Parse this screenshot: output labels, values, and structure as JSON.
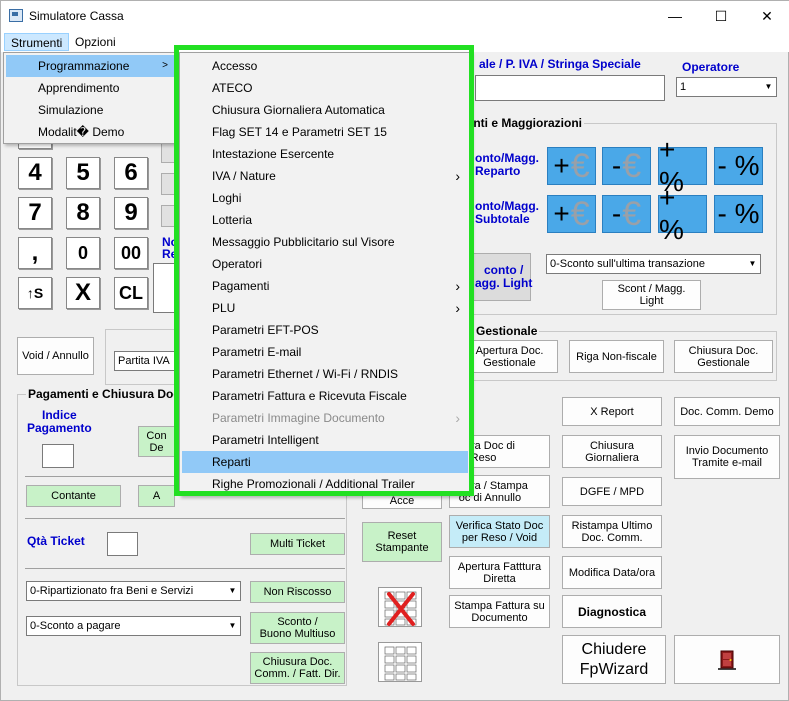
{
  "window": {
    "title": "Simulatore Cassa",
    "minimize": "—",
    "maximize": "☐",
    "close": "✕"
  },
  "menubar": {
    "strumenti": "Strumenti",
    "opzioni": "Opzioni"
  },
  "strumenti_menu": [
    "Programmazione",
    "Apprendimento",
    "Simulazione",
    "Modalit� Demo"
  ],
  "programmazione_menu": [
    {
      "label": "Accesso",
      "sub": false
    },
    {
      "label": "ATECO",
      "sub": false
    },
    {
      "label": "Chiusura Giornaliera Automatica",
      "sub": false
    },
    {
      "label": "Flag SET 14 e Parametri SET 15",
      "sub": false
    },
    {
      "label": "Intestazione Esercente",
      "sub": false
    },
    {
      "label": "IVA / Nature",
      "sub": true
    },
    {
      "label": "Loghi",
      "sub": false
    },
    {
      "label": "Lotteria",
      "sub": false
    },
    {
      "label": "Messaggio Pubblicitario sul Visore",
      "sub": false
    },
    {
      "label": "Operatori",
      "sub": false
    },
    {
      "label": "Pagamenti",
      "sub": true
    },
    {
      "label": "PLU",
      "sub": true
    },
    {
      "label": "Parametri EFT-POS",
      "sub": false
    },
    {
      "label": "Parametri E-mail",
      "sub": false
    },
    {
      "label": "Parametri Ethernet / Wi-Fi / RNDIS",
      "sub": false
    },
    {
      "label": "Parametri Fattura e Ricevuta Fiscale",
      "sub": false
    },
    {
      "label": "Parametri Immagine Documento",
      "sub": true,
      "disabled": true
    },
    {
      "label": "Parametri Intelligent",
      "sub": false
    },
    {
      "label": "Reparti",
      "sub": false,
      "highlighted": true
    },
    {
      "label": "Righe Promozionali / Additional Trailer",
      "sub": false
    }
  ],
  "header": {
    "cf_label": "ale / P. IVA / Stringa Speciale",
    "operatore_label": "Operatore",
    "operatore_value": "1"
  },
  "keypad": [
    "5",
    "6",
    "7",
    "8",
    "9",
    ",",
    "0",
    "00",
    "↑S",
    "X",
    "CL"
  ],
  "keypad_top": "4",
  "left_side": {
    "no_label": "No",
    "re_label": "Re",
    "void_annullo": "Void / Annullo",
    "partita_iva": "Partita IVA"
  },
  "sconti": {
    "title": "onti e Maggiorazioni",
    "reparto_label": "onto/Magg.\nReparto",
    "subtotale_label": "onto/Magg.\nSubtotale",
    "light_label": "conto /\nagg. Light",
    "plus_euro": "+€",
    "minus_euro": "-€",
    "plus_pct": "+ %",
    "minus_pct": "- %",
    "sconto_combo": "0-Sconto sull'ultima transazione",
    "scont_light_btn": "Scont / Magg.\nLight"
  },
  "gestionale": {
    "title": "c Gestionale",
    "apertura": "Apertura Doc.\nGestionale",
    "riga": "Riga Non-fiscale",
    "chiusura": "Chiusura Doc.\nGestionale"
  },
  "pagamenti": {
    "title": "Pagamenti e Chiusura Doc",
    "indice_label": "Indice\nPagamento",
    "con_de": "Con\nDe",
    "contante": "Contante",
    "a_btn": "A",
    "qta_label": "Qtà Ticket",
    "multi_ticket": "Multi Ticket",
    "ripart_combo": "0-Ripartizionato fra Beni e Servizi",
    "non_riscosso": "Non Riscosso",
    "sconto_combo": "0-Sconto a pagare",
    "sconto_buono": "Sconto /\nBuono Multiuso",
    "chiusura_doc": "Chiusura Doc.\nComm. / Fatt. Dir."
  },
  "middle": {
    "apertura_reso": "ertura Doc di\nReso",
    "apertura_annullo": "ertura / Stampa\noc di Annullo",
    "hidden_btn": "Acce",
    "reset": "Reset\nStampante",
    "verifica": "Verifica Stato Doc\nper Reso / Void",
    "apertura_fattura": "Apertura Fatttura\nDiretta",
    "stampa_fattura": "Stampa Fattura su\nDocumento"
  },
  "right": {
    "x_report": "X Report",
    "doc_comm_demo": "Doc. Comm. Demo",
    "chiusura_giornaliera": "Chiusura\nGiornaliera",
    "invio_documento": "Invio Documento\nTramite e-mail",
    "dgfe": "DGFE / MPD",
    "ristampa": "Ristampa Ultimo\nDoc. Comm.",
    "modifica_data": "Modifica Data/ora",
    "diagnostica": "Diagnostica",
    "chiudere": "Chiudere\nFpWizard"
  }
}
